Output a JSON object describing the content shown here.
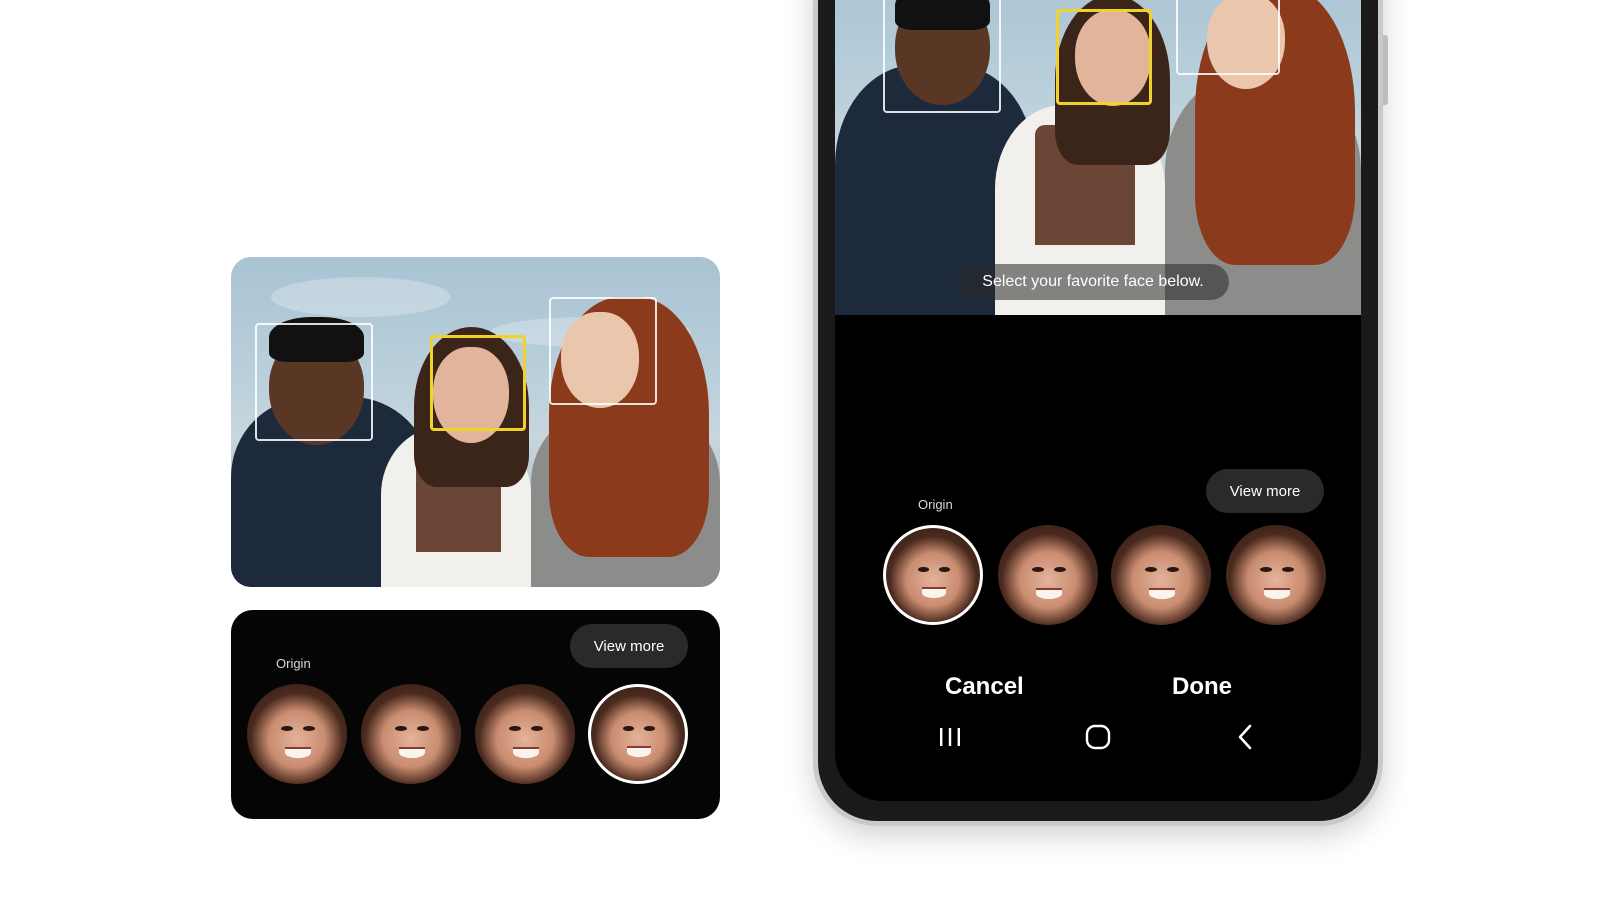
{
  "photo_hint": "Select your favorite face below.",
  "picker": {
    "origin_label": "Origin",
    "view_more_label": "View more",
    "faces": [
      "face-1",
      "face-2",
      "face-3",
      "face-4"
    ]
  },
  "actions": {
    "cancel_label": "Cancel",
    "done_label": "Done"
  },
  "navbar": {
    "recents_icon": "recents-icon",
    "home_icon": "home-icon",
    "back_icon": "back-icon"
  },
  "colors": {
    "selection_box": "#f1d22b",
    "face_box": "#ffffff",
    "screen_bg": "#000000",
    "pill_bg": "#2a2a2a"
  }
}
